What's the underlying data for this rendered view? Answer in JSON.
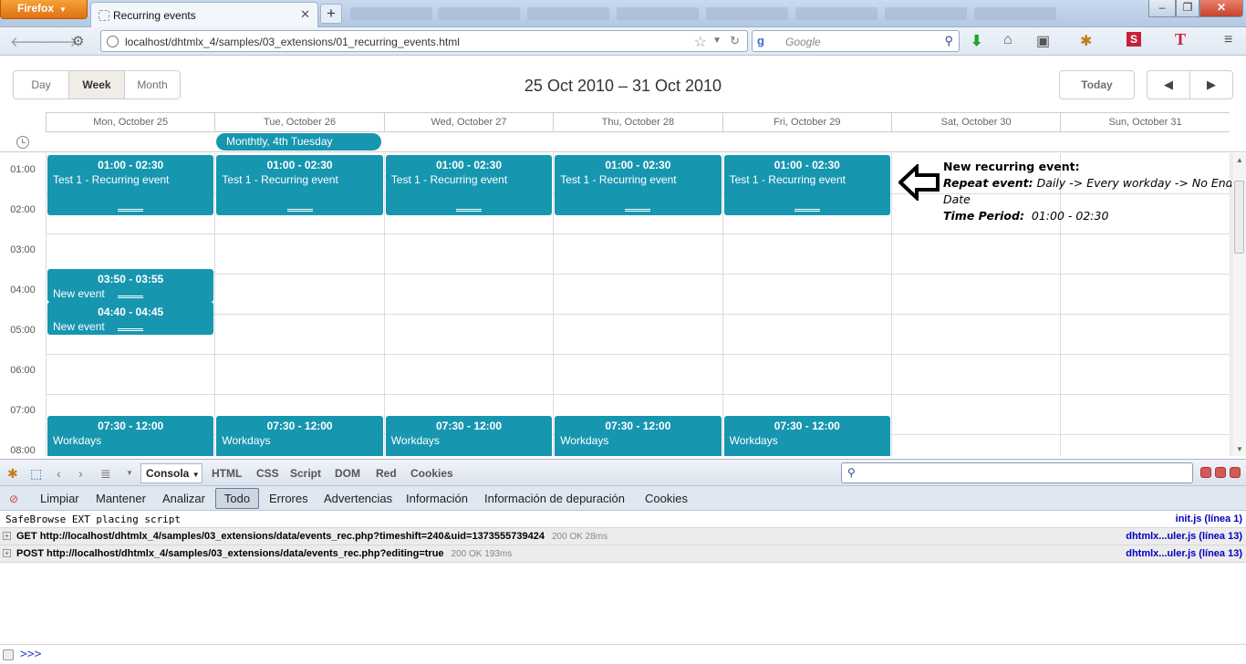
{
  "browser": {
    "menu_label": "Firefox",
    "tab_title": "Recurring events",
    "new_tab": "+",
    "url": "localhost/dhtmlx_4/samples/03_extensions/01_recurring_events.html",
    "search_placeholder": "Google",
    "window_min": "–",
    "window_max": "❐",
    "window_close": "✕"
  },
  "scheduler": {
    "view_tabs": [
      "Day",
      "Week",
      "Month"
    ],
    "active_view": "Week",
    "date_range": "25 Oct 2010 – 31 Oct 2010",
    "today_label": "Today",
    "prev": "◀",
    "next": "▶",
    "days": [
      "Mon, October 25",
      "Tue, October 26",
      "Wed, October 27",
      "Thu, October 28",
      "Fri, October 29",
      "Sat, October 30",
      "Sun, October 31"
    ],
    "multiday_event": "Monthtly, 4th Tuesday",
    "hours": [
      "01:00",
      "02:00",
      "03:00",
      "04:00",
      "05:00",
      "06:00",
      "07:00",
      "08:00"
    ],
    "events": [
      {
        "day": 0,
        "time": "01:00 - 02:30",
        "text": "Test 1 - Recurring event"
      },
      {
        "day": 1,
        "time": "01:00 - 02:30",
        "text": "Test 1 - Recurring event"
      },
      {
        "day": 2,
        "time": "01:00 - 02:30",
        "text": "Test 1 - Recurring event"
      },
      {
        "day": 3,
        "time": "01:00 - 02:30",
        "text": "Test 1 - Recurring event"
      },
      {
        "day": 4,
        "time": "01:00 - 02:30",
        "text": "Test 1 - Recurring event"
      },
      {
        "day": 0,
        "time": "03:50 - 03:55",
        "text": "New event"
      },
      {
        "day": 0,
        "time": "04:40 - 04:45",
        "text": "New event"
      },
      {
        "day": 0,
        "time": "07:30 - 12:00",
        "text": "Workdays"
      },
      {
        "day": 1,
        "time": "07:30 - 12:00",
        "text": "Workdays"
      },
      {
        "day": 2,
        "time": "07:30 - 12:00",
        "text": "Workdays"
      },
      {
        "day": 3,
        "time": "07:30 - 12:00",
        "text": "Workdays"
      },
      {
        "day": 4,
        "time": "07:30 - 12:00",
        "text": "Workdays"
      }
    ],
    "event_color": "#1796b0"
  },
  "annotation": {
    "title": "New recurring event:",
    "repeat_label": "Repeat event:",
    "repeat_value": "Daily -> Every workday -> No End Date",
    "period_label": "Time Period:",
    "period_value": "01:00 - 02:30"
  },
  "firebug": {
    "console_label": "Consola",
    "tabs": [
      "HTML",
      "CSS",
      "Script",
      "DOM",
      "Red",
      "Cookies"
    ],
    "filters": [
      "Limpiar",
      "Mantener",
      "Analizar",
      "Todo",
      "Errores",
      "Advertencias",
      "Información",
      "Información de depuración",
      "Cookies"
    ],
    "active_filter": "Todo",
    "log": [
      {
        "type": "text",
        "message": "SafeBrowse EXT placing script",
        "source": "init.js (línea 1)"
      },
      {
        "type": "net",
        "method": "GET",
        "url": "http://localhost/dhtmlx_4/samples/03_extensions/data/events_rec.php?timeshift=240&uid=1373555739424",
        "status": "200 OK 28ms",
        "source": "dhtmlx...uler.js (línea 13)"
      },
      {
        "type": "net",
        "method": "POST",
        "url": "http://localhost/dhtmlx_4/samples/03_extensions/data/events_rec.php?editing=true",
        "status": "200 OK 193ms",
        "source": "dhtmlx...uler.js (línea 13)"
      }
    ],
    "prompt": ">>>"
  }
}
